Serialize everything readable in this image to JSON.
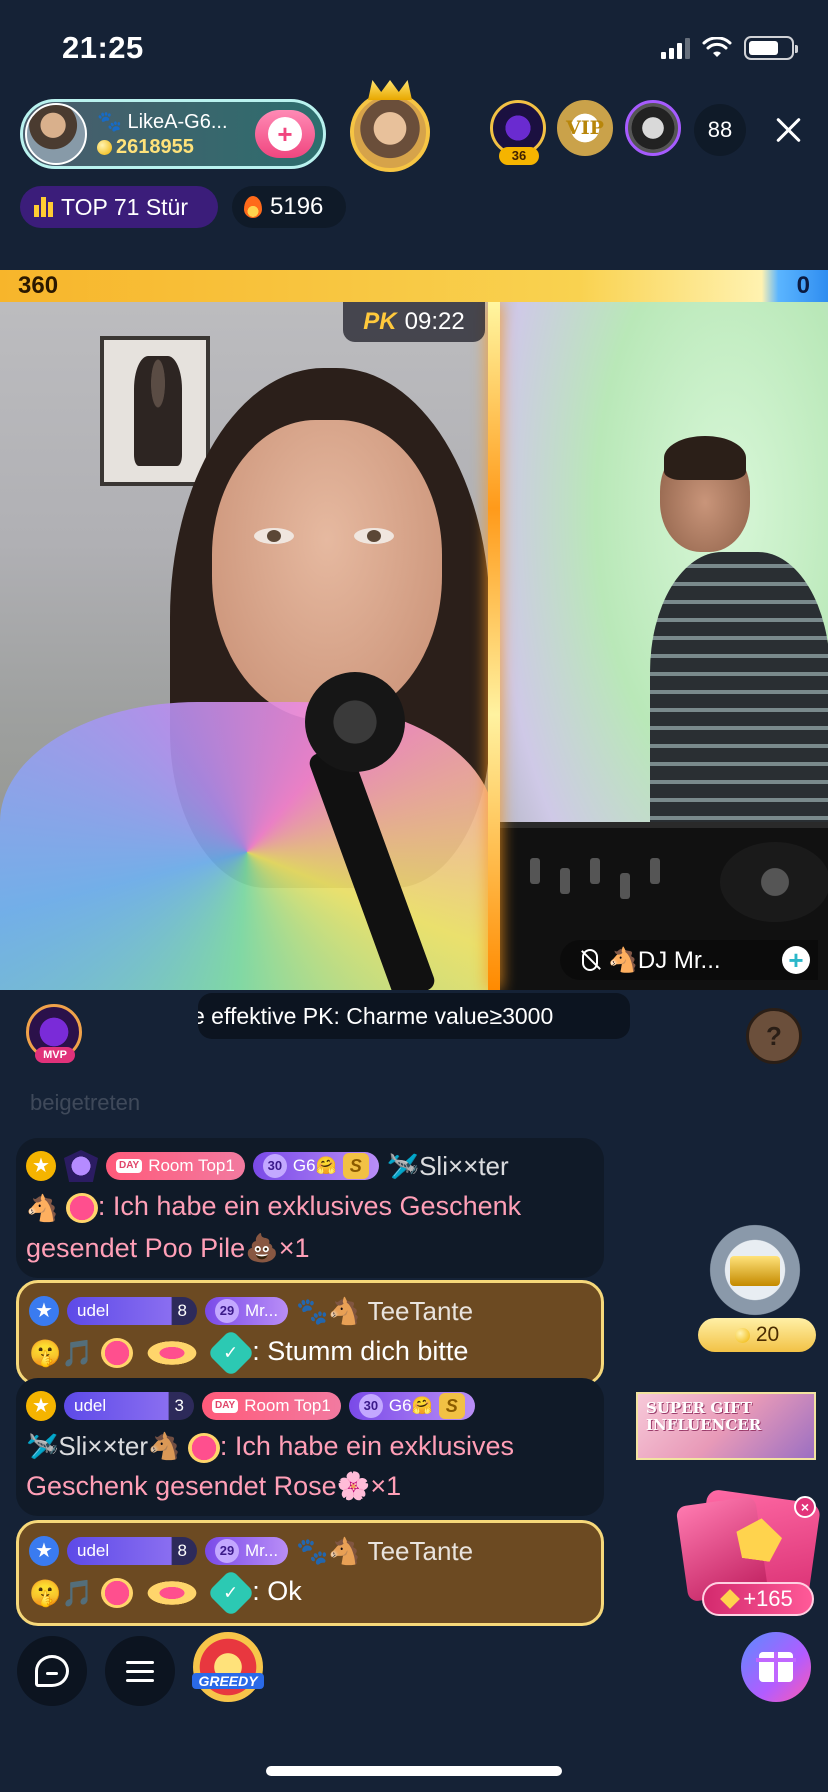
{
  "status_bar": {
    "time": "21:25"
  },
  "header": {
    "host_name": "🐾 LikeA-G6...",
    "host_coins": "2618955",
    "viewer_count": "88",
    "viewer_level": "36",
    "vip_badge": "VIP",
    "top_rank_label": "TOP 71 Stür",
    "heat_value": "5196"
  },
  "pk": {
    "left_score": "360",
    "right_score": "0",
    "label": "PK",
    "timer": "09:22",
    "opponent_name": "🐴DJ Mr...",
    "ticker_text": "e effektive PK: Charme value≥3000"
  },
  "chat": {
    "faded_text": "beigetreten",
    "messages": [
      {
        "badge_pill": "Room Top1",
        "day_tag": "DAY",
        "level": "30",
        "level_name": "G6🤗",
        "user": "🛩️Sli××ter",
        "text": ": Ich habe ein exklusives Geschenk gesendet Poo Pile💩×1"
      },
      {
        "pill": "udel",
        "pill_num": "8",
        "level": "29",
        "level_name": "Mr...",
        "user": "🐾🐴 TeeTante",
        "emojis": "🤫🎵",
        "text": ": Stumm dich bitte"
      },
      {
        "pill": "udel",
        "pill_num": "3",
        "badge_pill": "Room Top1",
        "day_tag": "DAY",
        "level": "30",
        "level_name": "G6🤗",
        "user": "🛩️Sli××ter🐴",
        "text": ": Ich habe ein exklusives Geschenk gesendet Rose🌸×1"
      },
      {
        "pill": "udel",
        "pill_num": "8",
        "level": "29",
        "level_name": "Mr...",
        "user": "🐾🐴 TeeTante",
        "emojis": "🤫🎵",
        "text": ": Ok"
      }
    ]
  },
  "widgets": {
    "medal_value": "20",
    "banner_text": "SUPER GIFT INFLUENCER",
    "lucky_value": "+165",
    "mvp_label": "MVP",
    "greedy_label": "GREEDY"
  },
  "colors": {
    "background": "#152236",
    "pk_left": "#f7b52b",
    "pk_right": "#2f8df0",
    "gold_message": "#6c4a22"
  }
}
